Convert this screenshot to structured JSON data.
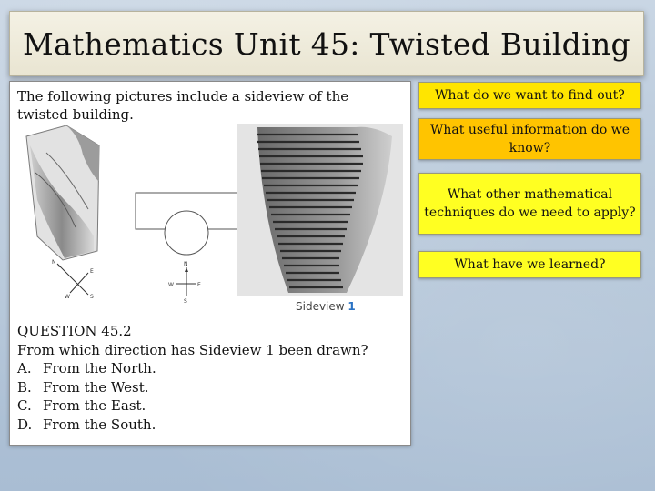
{
  "title": "Mathematics Unit 45: Twisted Building",
  "intro_text": "The following pictures include a sideview of the twisted building.",
  "figure": {
    "sideview_label": "Sideview",
    "sideview_number": "1",
    "compass_left": {
      "n": "N",
      "e": "E",
      "s": "S",
      "w": "W"
    },
    "compass_right": {
      "n": "N",
      "e": "E",
      "s": "S",
      "w": "W"
    }
  },
  "question": {
    "heading": "QUESTION 45.2",
    "text": "From which direction has Sideview 1 been drawn?",
    "options": [
      {
        "letter": "A.",
        "text": "From the North."
      },
      {
        "letter": "B.",
        "text": "From the West."
      },
      {
        "letter": "C.",
        "text": "From the East."
      },
      {
        "letter": "D.",
        "text": "From the South."
      }
    ]
  },
  "prompts": [
    "What do we want to find out?",
    "What useful information do we know?",
    "What other mathematical techniques do we need to apply?",
    "What have we learned?"
  ],
  "colors": {
    "prompt_1": "#ffe500",
    "prompt_2": "#ffc400",
    "prompt_3": "#ffff22",
    "prompt_4": "#ffff22",
    "sideview_number": "#2a72c4"
  }
}
